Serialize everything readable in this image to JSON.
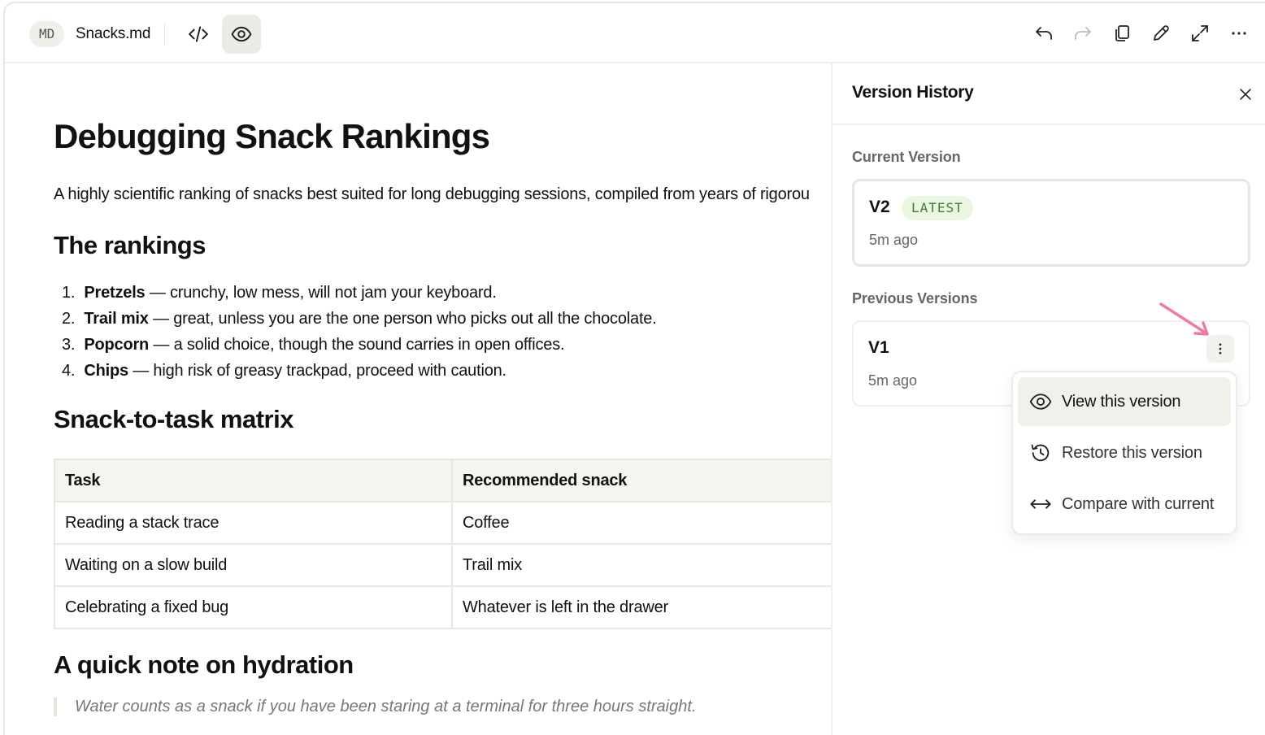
{
  "toolbar": {
    "format_badge": "MD",
    "file_name": "Snacks.md",
    "icons": [
      "code-icon",
      "eye-icon",
      "undo-icon",
      "redo-icon",
      "copy-icon",
      "pencil-icon",
      "expand-icon",
      "more-horizontal-icon"
    ],
    "active_view": "preview"
  },
  "document": {
    "title": "Debugging Snack Rankings",
    "intro": "A highly scientific ranking of snacks best suited for long debugging sessions, compiled from years of rigorou",
    "rankings_heading": "The rankings",
    "rankings": [
      {
        "num": "1.",
        "name": "Pretzels",
        "desc": " — crunchy, low mess, will not jam your keyboard."
      },
      {
        "num": "2.",
        "name": "Trail mix",
        "desc": " — great, unless you are the one person who picks out all the chocolate."
      },
      {
        "num": "3.",
        "name": "Popcorn",
        "desc": " — a solid choice, though the sound carries in open offices."
      },
      {
        "num": "4.",
        "name": "Chips",
        "desc": " — high risk of greasy trackpad, proceed with caution."
      }
    ],
    "matrix_heading": "Snack-to-task matrix",
    "matrix": {
      "headers": [
        "Task",
        "Recommended snack"
      ],
      "rows": [
        [
          "Reading a stack trace",
          "Coffee"
        ],
        [
          "Waiting on a slow build",
          "Trail mix"
        ],
        [
          "Celebrating a fixed bug",
          "Whatever is left in the drawer"
        ]
      ]
    },
    "hydration_heading": "A quick note on hydration",
    "quote": "Water counts as a snack if you have been staring at a terminal for three hours straight."
  },
  "version_panel": {
    "title": "Version History",
    "current_label": "Current Version",
    "current": {
      "name": "V2",
      "badge": "LATEST",
      "time": "5m ago"
    },
    "previous_label": "Previous Versions",
    "previous": [
      {
        "name": "V1",
        "time": "5m ago"
      }
    ]
  },
  "version_menu": {
    "items": [
      {
        "label": "View this version",
        "icon": "eye-icon"
      },
      {
        "label": "Restore this version",
        "icon": "history-icon"
      },
      {
        "label": "Compare with current",
        "icon": "arrows-horizontal-icon"
      }
    ]
  },
  "colors": {
    "accent_bg": "#e9ece4",
    "latest_badge_bg": "#eaf5e2",
    "latest_badge_text": "#3f7d2a",
    "pointer_arrow": "#f07aa6"
  }
}
